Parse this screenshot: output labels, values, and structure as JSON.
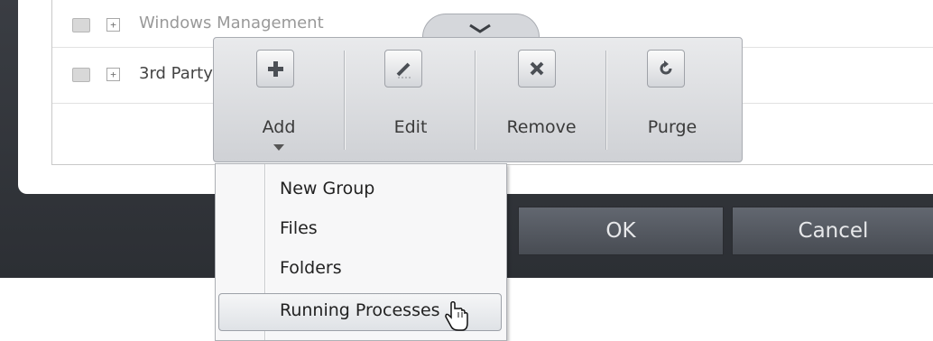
{
  "tree": {
    "rows": [
      {
        "label": "Windows Management",
        "expander": "+"
      },
      {
        "label": "3rd Party",
        "expander": "+"
      }
    ]
  },
  "toolbar": {
    "items": [
      {
        "label": "Add",
        "icon": "plus-icon"
      },
      {
        "label": "Edit",
        "icon": "pencil-icon"
      },
      {
        "label": "Remove",
        "icon": "x-icon"
      },
      {
        "label": "Purge",
        "icon": "refresh-icon"
      }
    ]
  },
  "add_menu": {
    "items": [
      "New Group",
      "Files",
      "Folders",
      "Running Processes"
    ],
    "highlighted": "Running Processes"
  },
  "dialog": {
    "ok_label": "OK",
    "cancel_label": "Cancel"
  },
  "colors": {
    "dialog_background": "#35383d",
    "button_background": "#555a62",
    "toolbar_background": "#dcdee1"
  }
}
